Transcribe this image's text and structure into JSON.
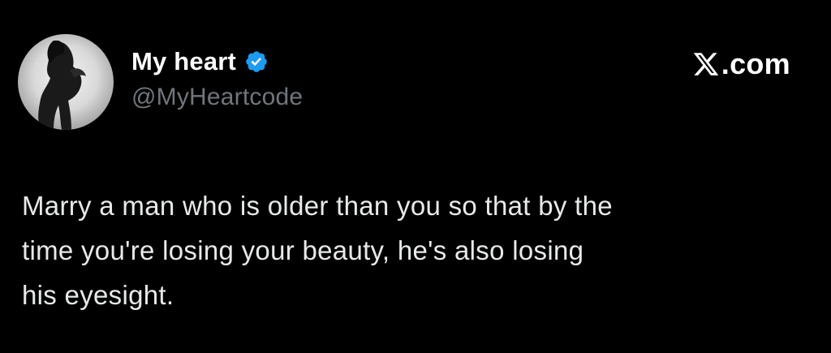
{
  "author": {
    "display_name": "My heart",
    "handle": "@MyHeartcode",
    "verified_icon": "verified-badge-icon",
    "avatar_icon": "profile-photo"
  },
  "brand": {
    "logo_icon": "x-logo-icon",
    "domain": ".com"
  },
  "tweet": {
    "lines": [
      "Marry a man who is older than you so that by the",
      "time you're losing your beauty, he's also losing",
      "his eyesight."
    ]
  },
  "colors": {
    "background": "#000000",
    "name": "#ffffff",
    "handle": "#71767b",
    "body_text": "#e7e9ea",
    "verified": "#1d9bf0"
  }
}
